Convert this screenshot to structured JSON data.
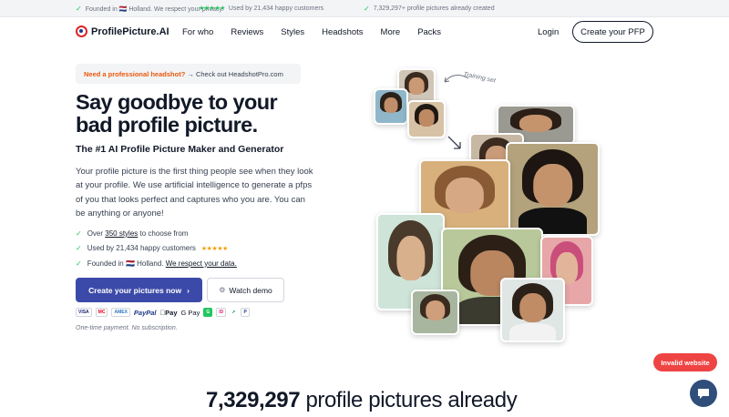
{
  "topbar": {
    "founded": "Founded in 🇳🇱 Holland. We respect your privacy.",
    "used_by": "Used by 21,434 happy customers",
    "stars": "★★★★★",
    "created": "7,329,297+ profile pictures already created"
  },
  "nav": {
    "logo": "ProfilePicture.AI",
    "links": [
      "For who",
      "Reviews",
      "Styles",
      "Headshots",
      "More",
      "Packs"
    ],
    "login": "Login",
    "cta": "Create your PFP"
  },
  "hero": {
    "promo_accent": "Need a professional headshot?",
    "promo_rest": " → Check out HeadshotPro.com",
    "title_line1": "Say goodbye to your",
    "title_line2": "bad profile picture.",
    "subtitle": "The #1 AI Profile Picture Maker and Generator",
    "paragraph": "Your profile picture is the first thing people see when they look at your profile. We use artificial intelligence to generate a pfps of you that looks perfect and captures who you are. You can be anything or anyone!",
    "bullets": {
      "styles_pre": "Over ",
      "styles_link": "350 styles",
      "styles_post": " to choose from",
      "customers": "Used by 21,434 happy customers",
      "customers_stars": "★★★★★",
      "founded": "Founded in 🇳🇱 Holland. ",
      "privacy_link": "We respect your data."
    },
    "primary_button": "Create your pictures now",
    "primary_arrow": "›",
    "secondary_button": "Watch demo",
    "payments": {
      "visa": "VISA",
      "mc": "MC",
      "amex": "AMEX",
      "paypal": "PayPal",
      "applepay": "Pay",
      "gpay": "G Pay",
      "extra1": "G",
      "extra2": "ID",
      "extra3": "P"
    },
    "footnote": "One-time payment. No subscription."
  },
  "collage": {
    "training_label": "Training set"
  },
  "stats": {
    "number": "7,329,297",
    "text": " profile pictures already"
  },
  "badges": {
    "invalid": "Invalid website"
  },
  "colors": {
    "accent_green": "#22c55e",
    "primary_button": "#3b4aa8",
    "invalid_red": "#ef4444",
    "chat_bubble": "#2f4f7a",
    "promo_orange": "#ea580c"
  }
}
